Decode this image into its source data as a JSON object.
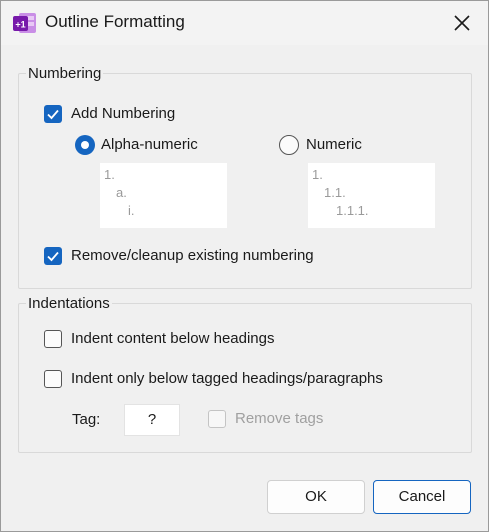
{
  "window": {
    "title": "Outline Formatting",
    "app_badge": "+1",
    "icon": "onenote-app-icon"
  },
  "numbering": {
    "legend": "Numbering",
    "add_numbering": {
      "label": "Add Numbering",
      "checked": true
    },
    "alpha": {
      "label": "Alpha-numeric",
      "selected": true,
      "preview": [
        "1.",
        "a.",
        "i."
      ]
    },
    "numeric": {
      "label": "Numeric",
      "selected": false,
      "preview": [
        "1.",
        "1.1.",
        "1.1.1."
      ]
    },
    "remove_existing": {
      "label": "Remove/cleanup existing numbering",
      "checked": true
    }
  },
  "indentations": {
    "legend": "Indentations",
    "indent_below_headings": {
      "label": "Indent content below headings",
      "checked": false
    },
    "indent_tagged": {
      "label": "Indent only below tagged headings/paragraphs",
      "checked": false
    },
    "tag_label": "Tag:",
    "tag_value": "?",
    "remove_tags": {
      "label": "Remove tags",
      "checked": false,
      "enabled": false
    }
  },
  "buttons": {
    "ok": "OK",
    "cancel": "Cancel"
  },
  "colors": {
    "accent": "#1565c0",
    "onenote_purple": "#7719aa",
    "disabled_text": "#a0a0a0"
  }
}
